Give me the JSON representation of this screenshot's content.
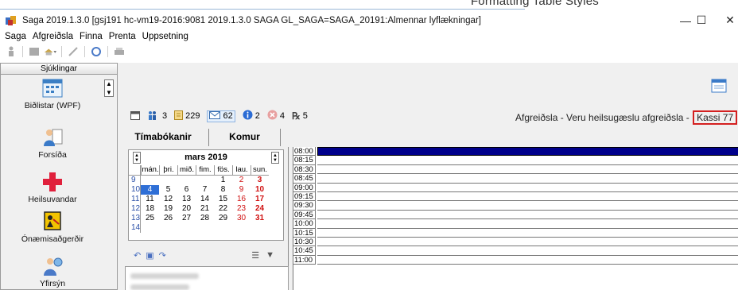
{
  "doc_strip": {
    "fragment": "Formatting    Table    Styles"
  },
  "window": {
    "title": "Saga 2019.1.3.0  [gsj191 hc-vm19-2016:9081 2019.1.3.0 SAGA GL_SAGA=SAGA_20191:Almennar lyflækningar]",
    "minimize": "—",
    "maximize": "☐",
    "close": "✕"
  },
  "menu": [
    "Saga",
    "Afgreiðsla",
    "Finna",
    "Prenta",
    "Uppsetning"
  ],
  "sidebar": {
    "header": "Sjúklingar",
    "items": [
      {
        "label": "Biðlistar (WPF)",
        "icon": "calendar-list-icon"
      },
      {
        "label": "Forsíða",
        "icon": "person-document-icon"
      },
      {
        "label": "Heilsuvandar",
        "icon": "medical-cross-icon"
      },
      {
        "label": "Ónæmisaðgerðir",
        "icon": "vaccination-icon"
      },
      {
        "label": "Yfirsýn",
        "icon": "person-globe-icon"
      }
    ]
  },
  "status": {
    "items": [
      {
        "icon": "calendar-icon",
        "value": ""
      },
      {
        "icon": "people-icon",
        "value": "3"
      },
      {
        "icon": "clipboard-icon",
        "value": "229"
      },
      {
        "icon": "envelope-icon",
        "value": "62"
      },
      {
        "icon": "info-icon",
        "value": "2"
      },
      {
        "icon": "cancel-icon",
        "value": "4"
      },
      {
        "icon": "prescription-icon",
        "value": "5"
      }
    ]
  },
  "location": {
    "text": "Afgreiðsla - Veru heilsugæslu afgreiðsla - ",
    "kassi": "Kassi 77"
  },
  "tabs": [
    "Tímabókanir",
    "Komur"
  ],
  "calendar": {
    "month": "mars 2019",
    "weekdays": [
      "mán.",
      "þri.",
      "mið.",
      "fim.",
      "fös.",
      "lau.",
      "sun."
    ],
    "weeks": [
      {
        "wk": "9",
        "days": [
          "",
          "",
          "",
          "",
          "1",
          "2",
          "3"
        ]
      },
      {
        "wk": "10",
        "days": [
          "4",
          "5",
          "6",
          "7",
          "8",
          "9",
          "10"
        ]
      },
      {
        "wk": "11",
        "days": [
          "11",
          "12",
          "13",
          "14",
          "15",
          "16",
          "17"
        ]
      },
      {
        "wk": "12",
        "days": [
          "18",
          "19",
          "20",
          "21",
          "22",
          "23",
          "24"
        ]
      },
      {
        "wk": "13",
        "days": [
          "25",
          "26",
          "27",
          "28",
          "29",
          "30",
          "31"
        ]
      },
      {
        "wk": "14",
        "days": [
          "",
          "",
          "",
          "",
          "",
          "",
          ""
        ]
      }
    ],
    "selected_day": "4"
  },
  "schedule": {
    "times": [
      "08:00",
      "08:15",
      "08:30",
      "08:45",
      "09:00",
      "09:15",
      "09:30",
      "09:45",
      "10:00",
      "10:15",
      "10:30",
      "10:45",
      "11:00"
    ]
  }
}
